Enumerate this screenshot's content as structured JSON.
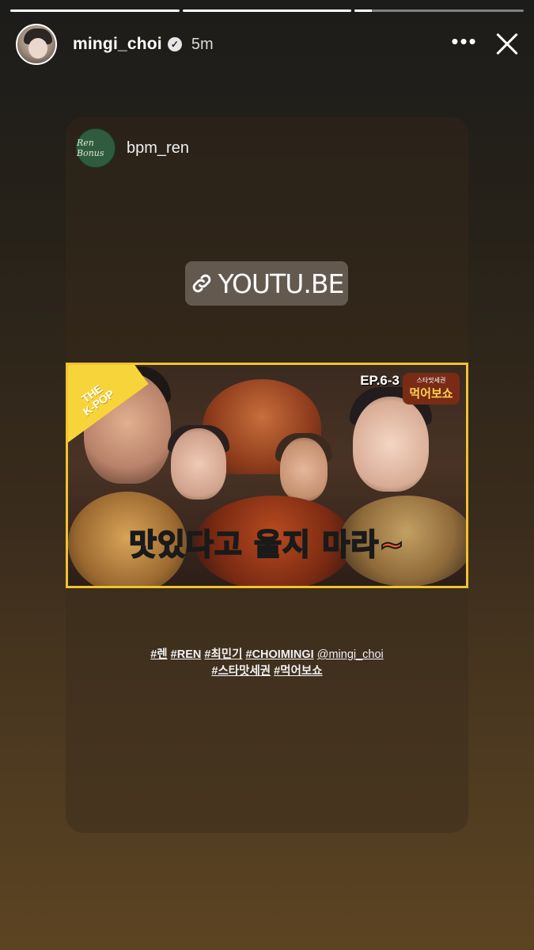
{
  "progress": [
    1,
    1,
    0.1
  ],
  "header": {
    "username": "mingi_choi",
    "time": "5m",
    "verified_icon": "verified-badge-icon",
    "more_icon": "more-icon",
    "close_icon": "close-icon"
  },
  "card": {
    "username": "bpm_ren",
    "avatar_text": "Ren Bonus"
  },
  "link": {
    "text": "YOUTU.BE",
    "icon": "link-icon"
  },
  "thumbnail": {
    "badge": "THE\nK-POP",
    "episode": "EP.6-3",
    "show_sub": "스타맛세권",
    "show_title": "먹어보쇼",
    "caption_part1": "맛있다고 울지 ",
    "caption_part2": "마라~"
  },
  "tags": {
    "t1": "#렌",
    "t2": "#REN",
    "t3": "#최민기",
    "t4": "#CHOIMINGI",
    "mention": "@mingi_choi",
    "t5": "#스타맛세권",
    "t6": "#먹어보쇼"
  }
}
